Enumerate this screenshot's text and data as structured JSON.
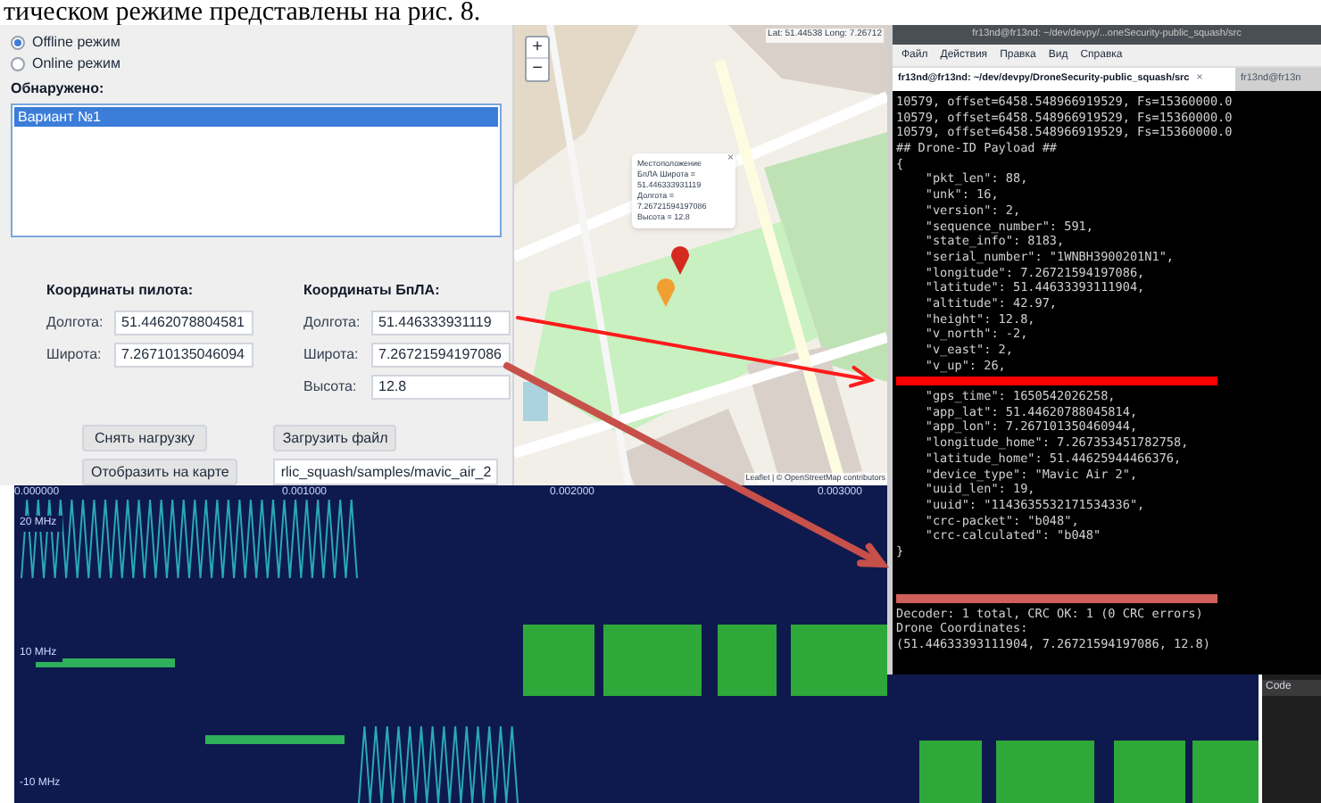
{
  "caption": "тическом режиме представлены на рис. 8.",
  "app": {
    "modes": [
      {
        "label": "Offline режим",
        "selected": true
      },
      {
        "label": "Online режим",
        "selected": false
      }
    ],
    "detected_label": "Обнаружено:",
    "detected_items": [
      {
        "label": "Вариант №1",
        "selected": true
      }
    ],
    "groups": [
      {
        "title": "Координаты пилота:",
        "fields": [
          {
            "label": "Долгота:",
            "value": "51.4462078804581"
          },
          {
            "label": "Широта:",
            "value": "7.26710135046094"
          }
        ]
      },
      {
        "title": "Координаты БпЛА:",
        "fields": [
          {
            "label": "Долгота:",
            "value": "51.446333931119"
          },
          {
            "label": "Широта:",
            "value": "7.26721594197086"
          },
          {
            "label": "Высота:",
            "value": "12.8"
          }
        ]
      }
    ],
    "buttons": [
      "Снять нагрузку",
      "Загрузить файл",
      "Отобразить на карте"
    ],
    "file_path": "rlic_squash/samples/mavic_air_2"
  },
  "map": {
    "zoom_in": "+",
    "zoom_out": "−",
    "coords": "Lat: 51.44538 Long: 7.26712",
    "popup": {
      "lines": [
        "Местоположение",
        "БпЛА Широта =",
        "51.446333931119",
        "Долгота =",
        "7.26721594197086",
        "Высота = 12.8"
      ],
      "close": "×"
    },
    "attribution": "Leaflet | © OpenStreetMap contributors"
  },
  "terminal": {
    "title": "fr13nd@fr13nd: ~/dev/devpy/...oneSecurity-public_squash/src",
    "menu": [
      "Файл",
      "Действия",
      "Правка",
      "Вид",
      "Справка"
    ],
    "tabs": [
      {
        "label": "fr13nd@fr13nd: ~/dev/devpy/DroneSecurity-public_squash/src",
        "selected": true,
        "close": "×"
      },
      {
        "label": "fr13nd@fr13n",
        "selected": false
      }
    ],
    "lines": [
      {
        "kind": "text",
        "text": "10579, offset=6458.548966919529, Fs=15360000.0"
      },
      {
        "kind": "text",
        "text": "10579, offset=6458.548966919529, Fs=15360000.0"
      },
      {
        "kind": "text",
        "text": "10579, offset=6458.548966919529, Fs=15360000.0"
      },
      {
        "kind": "text",
        "text": "## Drone-ID Payload ##"
      },
      {
        "kind": "text",
        "text": "{"
      },
      {
        "kind": "text",
        "text": "    \"pkt_len\": 88,"
      },
      {
        "kind": "text",
        "text": "    \"unk\": 16,"
      },
      {
        "kind": "text",
        "text": "    \"version\": 2,"
      },
      {
        "kind": "text",
        "text": "    \"sequence_number\": 591,"
      },
      {
        "kind": "text",
        "text": "    \"state_info\": 8183,"
      },
      {
        "kind": "text",
        "text": "    \"serial_number\": \"1WNBH3900201N1\","
      },
      {
        "kind": "text",
        "text": "    \"longitude\": 7.26721594197086,"
      },
      {
        "kind": "text",
        "text": "    \"latitude\": 51.44633393111904,"
      },
      {
        "kind": "text",
        "text": "    \"altitude\": 42.97,"
      },
      {
        "kind": "text",
        "text": "    \"height\": 12.8,"
      },
      {
        "kind": "text",
        "text": "    \"v_north\": -2,"
      },
      {
        "kind": "text",
        "text": "    \"v_east\": 2,"
      },
      {
        "kind": "text",
        "text": "    \"v_up\": 26,"
      },
      {
        "kind": "marked",
        "color": "#ff0000"
      },
      {
        "kind": "text",
        "text": "    \"gps_time\": 1650542026258,"
      },
      {
        "kind": "text",
        "text": "    \"app_lat\": 51.44620788045814,"
      },
      {
        "kind": "text",
        "text": "    \"app_lon\": 7.267101350460944,"
      },
      {
        "kind": "text",
        "text": "    \"longitude_home\": 7.267353451782758,"
      },
      {
        "kind": "text",
        "text": "    \"latitude_home\": 51.44625944466376,"
      },
      {
        "kind": "text",
        "text": "    \"device_type\": \"Mavic Air 2\","
      },
      {
        "kind": "text",
        "text": "    \"uuid_len\": 19,"
      },
      {
        "kind": "text",
        "text": "    \"uuid\": \"1143635532171534336\","
      },
      {
        "kind": "text",
        "text": "    \"crc-packet\": \"b048\","
      },
      {
        "kind": "text",
        "text": "    \"crc-calculated\": \"b048\""
      },
      {
        "kind": "text",
        "text": "}"
      },
      {
        "kind": "blank"
      },
      {
        "kind": "blank"
      },
      {
        "kind": "marked",
        "color": "#d0605a"
      },
      {
        "kind": "text",
        "text": "Decoder: 1 total, CRC OK: 1 (0 CRC errors)"
      },
      {
        "kind": "text",
        "text": "Drone Coordinates:"
      },
      {
        "kind": "text",
        "text": "(51.44633393111904, 7.26721594197086, 12.8)"
      }
    ]
  },
  "spectrogram": {
    "time_ticks": [
      "0.000000",
      "0.001000",
      "0.002000",
      "0.003000"
    ],
    "freq_labels": [
      "20 MHz",
      "10 MHz",
      "-10 MHz"
    ]
  },
  "side_panel": {
    "items": [
      "Code"
    ]
  },
  "annotations": [
    {
      "color": "#ff1a1a"
    },
    {
      "color": "#c8504a"
    }
  ]
}
